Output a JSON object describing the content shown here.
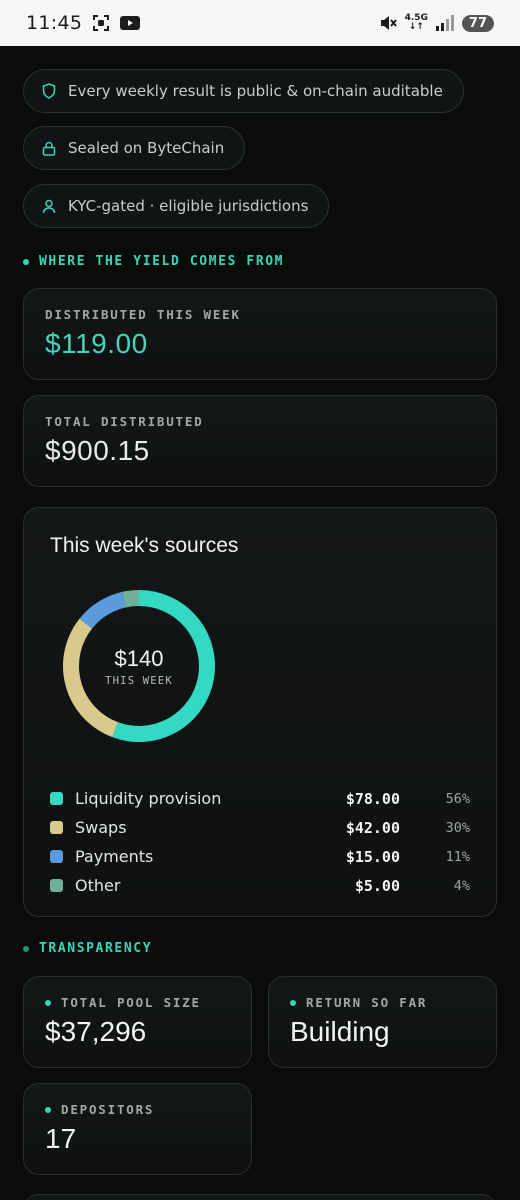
{
  "status_bar": {
    "time": "11:45",
    "network": "4.5G",
    "battery": "77"
  },
  "badges": [
    {
      "icon": "shield-icon",
      "text": "Every weekly result is public & on-chain auditable"
    },
    {
      "icon": "lock-icon",
      "text": "Sealed on ByteChain"
    },
    {
      "icon": "user-icon",
      "text": "KYC-gated · eligible jurisdictions"
    }
  ],
  "yield_section": {
    "label": "WHERE THE YIELD COMES FROM",
    "distributed_week_label": "DISTRIBUTED THIS WEEK",
    "distributed_week_value": "$119.00",
    "total_distributed_label": "TOTAL DISTRIBUTED",
    "total_distributed_value": "$900.15"
  },
  "sources": {
    "title": "This week's sources",
    "center_value": "$140",
    "center_label": "THIS WEEK"
  },
  "chart_data": {
    "type": "pie",
    "categories": [
      "Liquidity provision",
      "Swaps",
      "Payments",
      "Other"
    ],
    "values": [
      78,
      42,
      15,
      5
    ],
    "amount_labels": [
      "$78.00",
      "$42.00",
      "$15.00",
      "$5.00"
    ],
    "percent_labels": [
      "56%",
      "30%",
      "11%",
      "4%"
    ],
    "colors": [
      "#34d9c3",
      "#d8c98c",
      "#5b9bdc",
      "#6fae97"
    ],
    "donut": true
  },
  "transparency": {
    "label": "TRANSPARENCY",
    "pool_size_label": "TOTAL POOL SIZE",
    "pool_size_value": "$37,296",
    "return_label": "RETURN SO FAR",
    "return_value": "Building",
    "depositors_label": "DEPOSITORS",
    "depositors_value": "17"
  }
}
